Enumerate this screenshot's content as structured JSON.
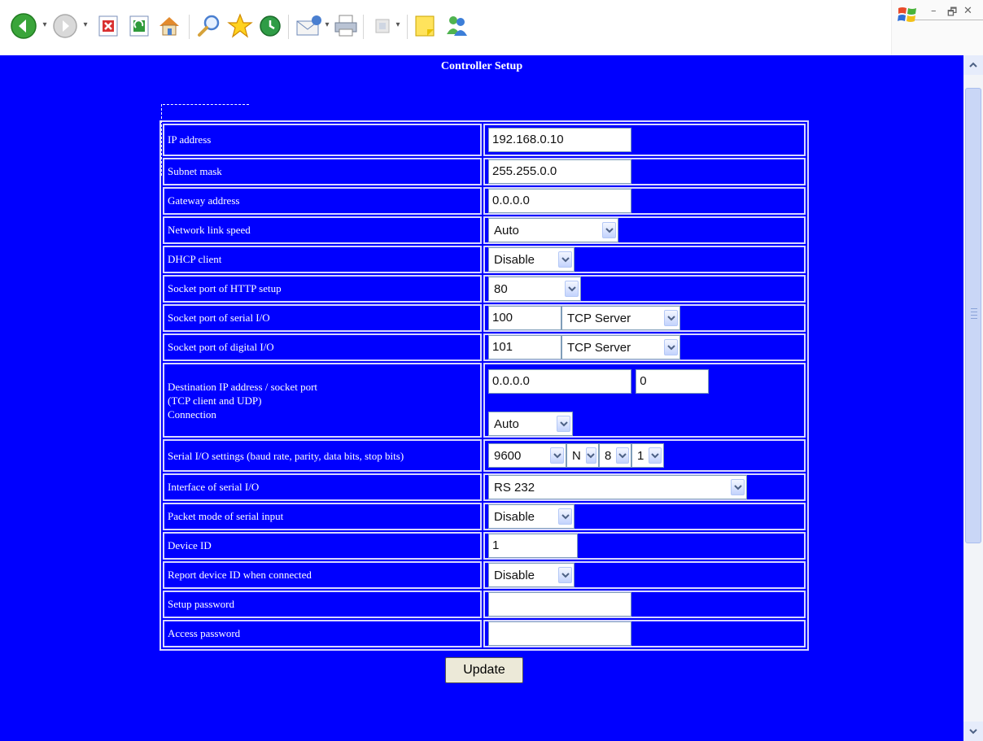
{
  "toolbar": {
    "buttons": [
      "back-icon",
      "forward-icon",
      "stop-icon",
      "refresh-icon",
      "home-icon",
      "search-icon",
      "favorites-icon",
      "history-icon",
      "mail-icon",
      "print-icon",
      "edit-icon",
      "notes-icon",
      "messenger-icon"
    ],
    "window_controls": {
      "minimize": "–",
      "restore": "🗗",
      "close": "✕"
    }
  },
  "page": {
    "title": "Controller Setup",
    "colors": {
      "background": "#0000ff",
      "text": "#ffffff",
      "border": "#d8d8ff"
    }
  },
  "rows": {
    "ip": {
      "label": "IP address",
      "value": "192.168.0.10"
    },
    "subnet": {
      "label": "Subnet mask",
      "value": "255.255.0.0"
    },
    "gateway": {
      "label": "Gateway address",
      "value": "0.0.0.0"
    },
    "link_speed": {
      "label": "Network link speed",
      "value": "Auto"
    },
    "dhcp": {
      "label": "DHCP client",
      "value": "Disable"
    },
    "http_port": {
      "label": "Socket port of HTTP setup",
      "value": "80"
    },
    "serial_port": {
      "label": "Socket port of serial I/O",
      "port": "100",
      "mode": "TCP Server"
    },
    "digital_port": {
      "label": "Socket port of digital I/O",
      "port": "101",
      "mode": "TCP Server"
    },
    "destination": {
      "label_line1": "Destination IP address / socket port",
      "label_line2": "(TCP client and UDP)",
      "label_line3": "Connection",
      "ip": "0.0.0.0",
      "port": "0",
      "connection": "Auto"
    },
    "serial_settings": {
      "label": "Serial I/O settings (baud rate, parity, data bits, stop bits)",
      "baud": "9600",
      "parity": "N",
      "data_bits": "8",
      "stop_bits": "1"
    },
    "interface": {
      "label": "Interface of serial I/O",
      "value": "RS 232"
    },
    "packet_mode": {
      "label": "Packet mode of serial input",
      "value": "Disable"
    },
    "device_id": {
      "label": "Device ID",
      "value": "1"
    },
    "report_id": {
      "label": "Report device ID when connected",
      "value": "Disable"
    },
    "setup_password": {
      "label": "Setup password",
      "value": ""
    },
    "access_password": {
      "label": "Access password",
      "value": ""
    }
  },
  "update_button": "Update"
}
